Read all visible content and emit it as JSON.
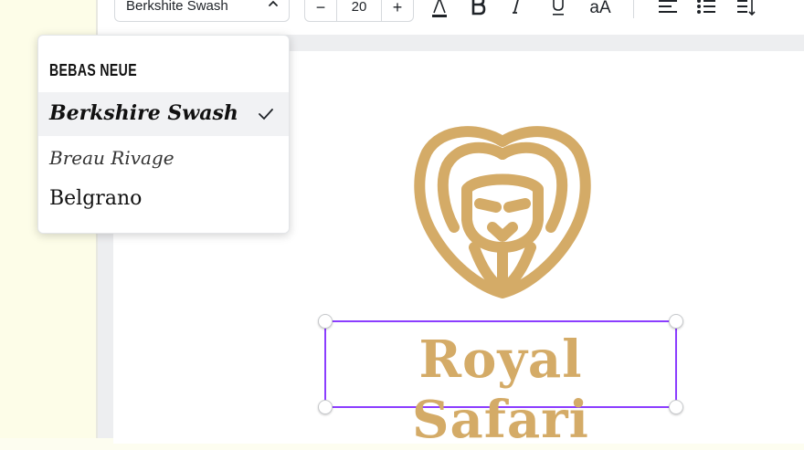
{
  "toolbar": {
    "font_value": "Berkshite Swash",
    "size_minus": "−",
    "font_size": "20",
    "size_plus": "+",
    "text_color_icon": "text-color-icon",
    "bold_icon": "bold-icon",
    "italic_icon": "italic-icon",
    "underline_icon": "underline-icon",
    "case_label": "aA",
    "align_icon": "align-left-icon",
    "list_icon": "list-icon",
    "spacing_icon": "spacing-icon"
  },
  "font_dropdown": {
    "items": [
      {
        "label": "BEBAS NEUE"
      },
      {
        "label": "Berkshire Swash",
        "selected": true
      },
      {
        "label": "Breau Rivage"
      },
      {
        "label": "Belgrano"
      }
    ]
  },
  "canvas": {
    "logo_icon": "lion-head-icon",
    "text": "Royal Safari"
  },
  "colors": {
    "accent": "#8b3dff",
    "gold": "#d4ab67"
  }
}
